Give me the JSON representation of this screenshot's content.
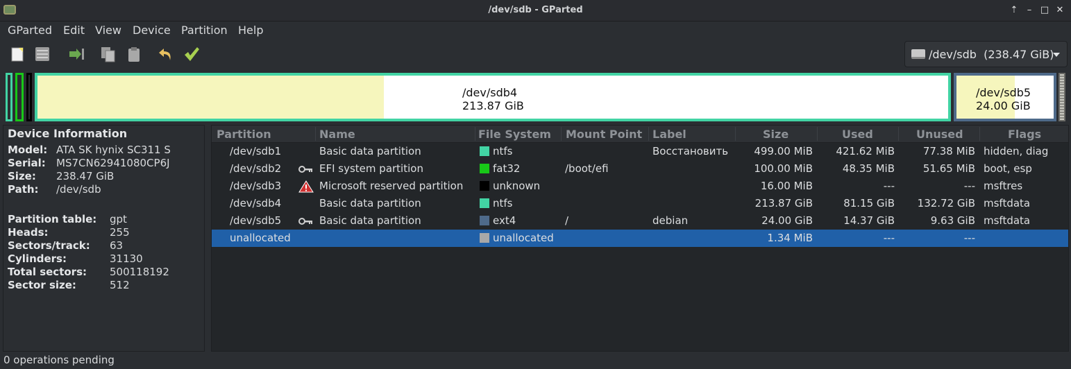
{
  "window": {
    "title": "/dev/sdb - GParted"
  },
  "window_buttons": [
    "⇡",
    "–",
    "□",
    "✕"
  ],
  "menu": [
    "GParted",
    "Edit",
    "View",
    "Device",
    "Partition",
    "Help"
  ],
  "toolbar": {
    "items": [
      "new-icon",
      "delete-icon",
      "resize-move-icon",
      "copy-icon",
      "paste-icon",
      "undo-icon",
      "apply-icon"
    ]
  },
  "device_selector": {
    "value": "/dev/sdb  (238.47 GiB)",
    "icon": "drive-icon"
  },
  "partition_map": {
    "sdb4": {
      "name": "/dev/sdb4",
      "size": "213.87 GiB",
      "used_fraction": 0.38
    },
    "sdb5": {
      "name": "/dev/sdb5",
      "size": "24.00 GiB",
      "used_fraction": 0.6
    }
  },
  "device_info": {
    "header": "Device Information",
    "model_label": "Model:",
    "model": "ATA SK hynix SC311 S",
    "serial_label": "Serial:",
    "serial": "MS7CN62941080CP6J",
    "size_label": "Size:",
    "size": "238.47 GiB",
    "path_label": "Path:",
    "path": "/dev/sdb",
    "ptable_label": "Partition table:",
    "ptable": "gpt",
    "heads_label": "Heads:",
    "heads": "255",
    "sectors_track_label": "Sectors/track:",
    "sectors_track": "63",
    "cylinders_label": "Cylinders:",
    "cylinders": "31130",
    "total_sectors_label": "Total sectors:",
    "total_sectors": "500118192",
    "sector_size_label": "Sector size:",
    "sector_size": "512"
  },
  "columns": [
    "Partition",
    "Name",
    "File System",
    "Mount Point",
    "Label",
    "Size",
    "Used",
    "Unused",
    "Flags"
  ],
  "rows": [
    {
      "partition": "/dev/sdb1",
      "icon": "",
      "name": "Basic data partition",
      "fs": "ntfs",
      "fs_color": "#42d4a4",
      "mount": "",
      "label": "Восстановить",
      "size": "499.00 MiB",
      "used": "421.62 MiB",
      "unused": "77.38 MiB",
      "flags": "hidden, diag"
    },
    {
      "partition": "/dev/sdb2",
      "icon": "key-icon",
      "name": "EFI system partition",
      "fs": "fat32",
      "fs_color": "#18c818",
      "mount": "/boot/efi",
      "label": "",
      "size": "100.00 MiB",
      "used": "48.35 MiB",
      "unused": "51.65 MiB",
      "flags": "boot, esp"
    },
    {
      "partition": "/dev/sdb3",
      "icon": "warning-icon",
      "name": "Microsoft reserved partition",
      "fs": "unknown",
      "fs_color": "#000000",
      "mount": "",
      "label": "",
      "size": "16.00 MiB",
      "used": "---",
      "unused": "---",
      "flags": "msftres"
    },
    {
      "partition": "/dev/sdb4",
      "icon": "",
      "name": "Basic data partition",
      "fs": "ntfs",
      "fs_color": "#42d4a4",
      "mount": "",
      "label": "",
      "size": "213.87 GiB",
      "used": "81.15 GiB",
      "unused": "132.72 GiB",
      "flags": "msftdata"
    },
    {
      "partition": "/dev/sdb5",
      "icon": "key-icon",
      "name": "Basic data partition",
      "fs": "ext4",
      "fs_color": "#4e6a8a",
      "mount": "/",
      "label": "debian",
      "size": "24.00 GiB",
      "used": "14.37 GiB",
      "unused": "9.63 GiB",
      "flags": "msftdata"
    },
    {
      "partition": "unallocated",
      "icon": "",
      "name": "",
      "fs": "unallocated",
      "fs_color": "#a8a8a8",
      "mount": "",
      "label": "",
      "size": "1.34 MiB",
      "used": "---",
      "unused": "---",
      "flags": ""
    }
  ],
  "selected_row": 5,
  "status": {
    "text": "0 operations pending"
  }
}
